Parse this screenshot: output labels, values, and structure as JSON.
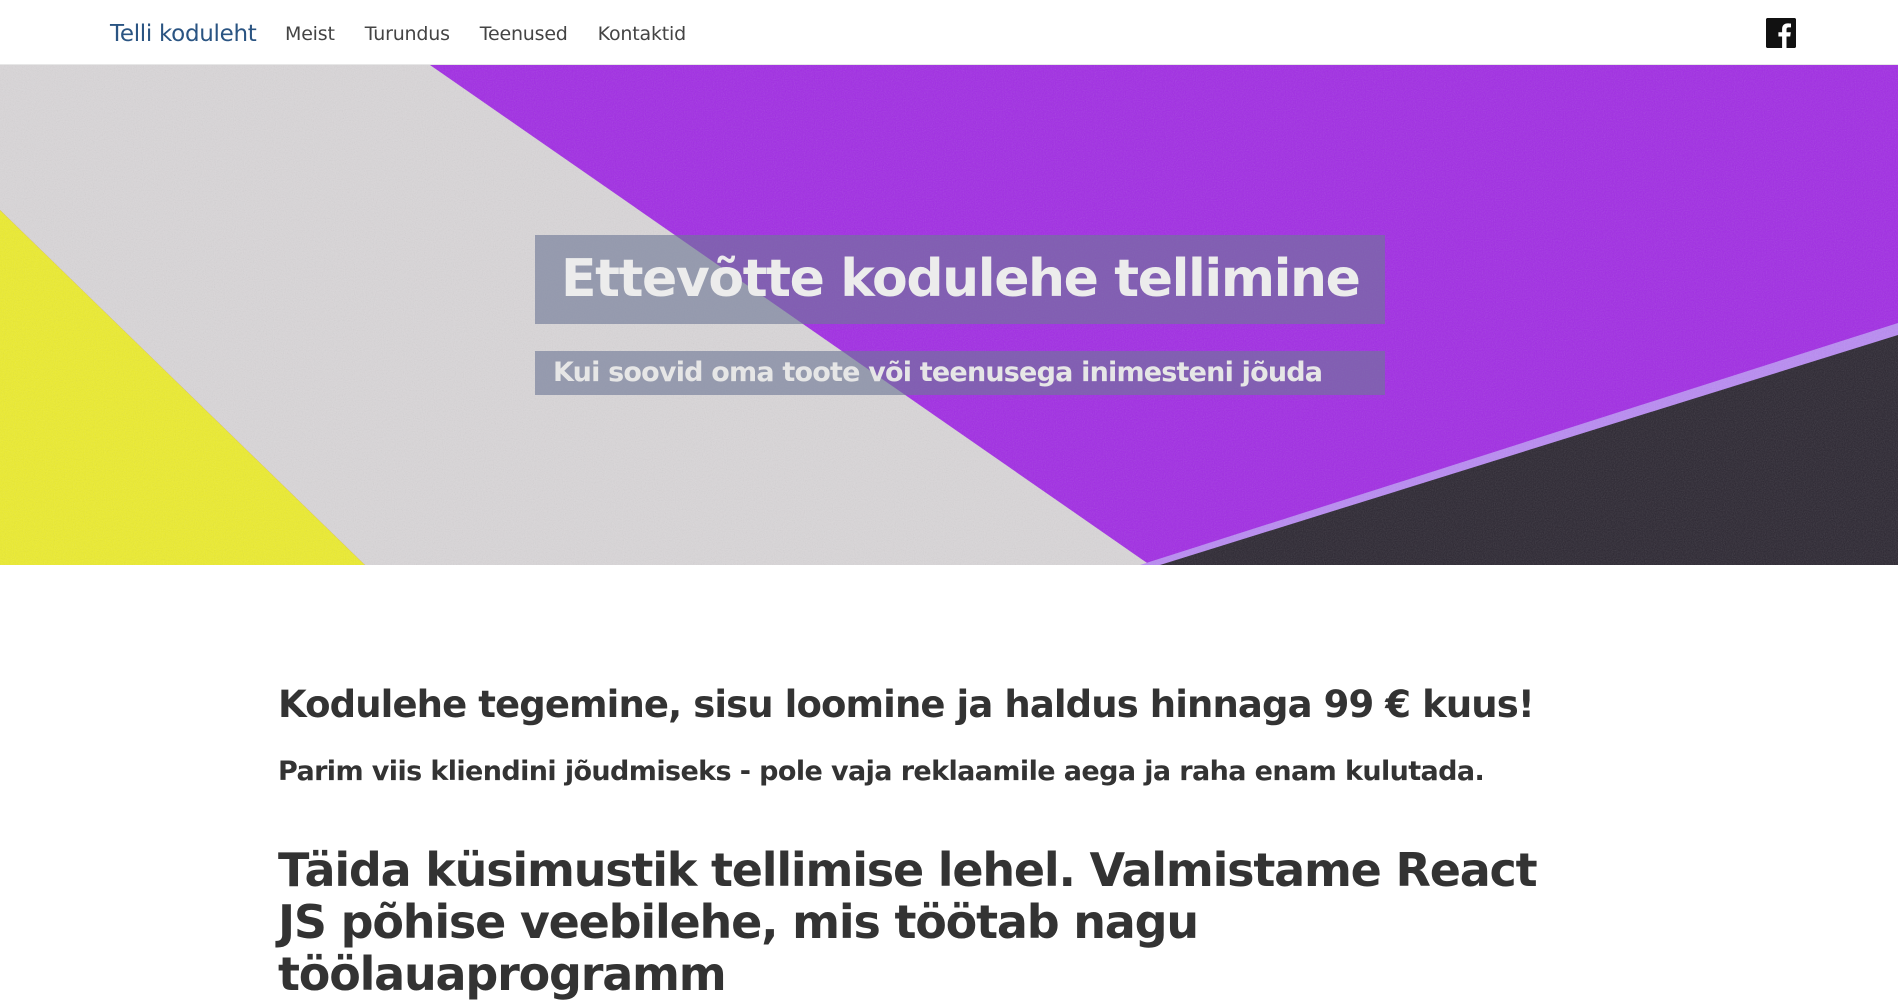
{
  "navbar": {
    "brand": "Telli koduleht",
    "links": [
      {
        "label": "Meist"
      },
      {
        "label": "Turundus"
      },
      {
        "label": "Teenused"
      },
      {
        "label": "Kontaktid"
      }
    ],
    "social_icon": "facebook-icon"
  },
  "hero": {
    "title": "Ettevõtte kodulehe tellimine",
    "subtitle": "Kui soovid oma toote või teenusega inimesteni jõuda",
    "colors": {
      "yellow": "#ecec2e",
      "grey": "#d9d6d8",
      "purple": "#a12ce4",
      "dark": "#2b2631",
      "edge": "#b98bf3"
    }
  },
  "main": {
    "headline": "Kodulehe tegemine, sisu loomine ja haldus hinnaga 99 € kuus!",
    "subheadline": "Parim viis kliendini jõudmiseks - pole vaja reklaamile aega ja raha enam kulutada.",
    "cta_text": "Täida küsimustik tellimise lehel. Valmistame React JS põhise veebilehe, mis töötab nagu töölauaprogramm"
  },
  "colors": {
    "brand": "#2a5482",
    "text": "#333333"
  }
}
